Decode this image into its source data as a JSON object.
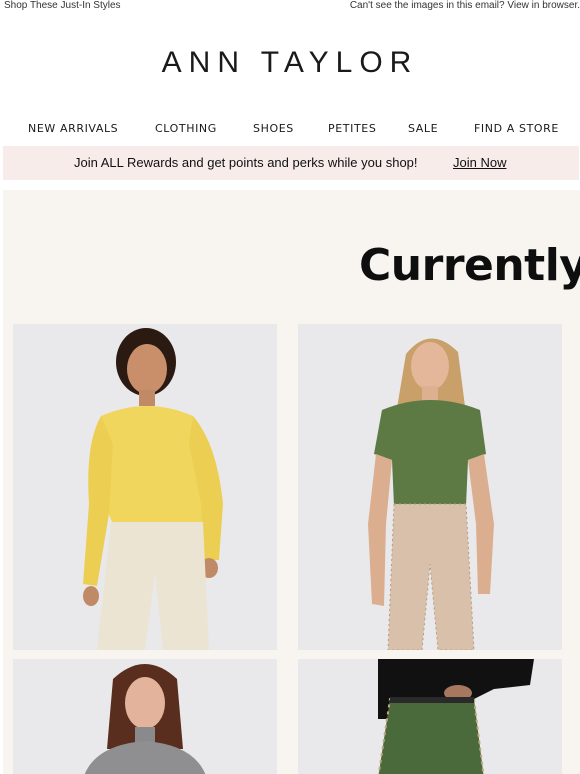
{
  "preheader": {
    "left_text": "Shop These Just-In Styles",
    "right_text": "Can't see the images in this email? View in browser."
  },
  "brand": {
    "logo_text": "ANN TAYLOR"
  },
  "nav": {
    "items": [
      {
        "label": "NEW ARRIVALS"
      },
      {
        "label": "CLOTHING"
      },
      {
        "label": "SHOES"
      },
      {
        "label": "PETITES"
      },
      {
        "label": "SALE"
      },
      {
        "label": "FIND A STORE"
      }
    ]
  },
  "rewards": {
    "message": "Join ALL Rewards and get points and perks while you shop!",
    "link_label": "Join Now"
  },
  "hero": {
    "headline": "Currently"
  },
  "products": [
    {
      "image": "model-yellow-puff-sleeve-top-cream-jeans"
    },
    {
      "image": "model-green-draped-top-houndstooth-pants"
    },
    {
      "image": "model-gray-turtleneck"
    },
    {
      "image": "model-tweed-skirt-black-top"
    }
  ],
  "colors": {
    "rewards_bg": "#f7ecea",
    "panel_bg": "#f8f5f1",
    "tile_bg": "#e8e8ea",
    "yellow_top": "#f0d65c",
    "green_top": "#5d7a45"
  }
}
